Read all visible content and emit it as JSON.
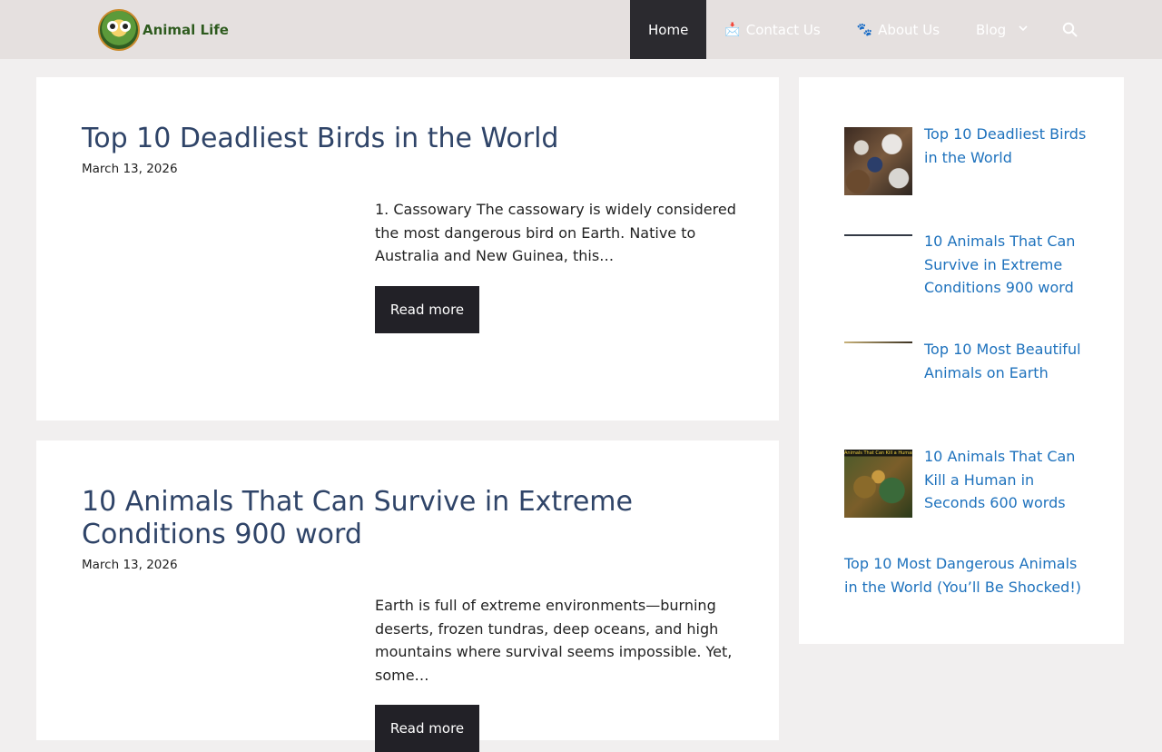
{
  "header": {
    "logo_text": "Animal Life",
    "nav": [
      {
        "label": "Home",
        "icon": ""
      },
      {
        "label": "Contact Us",
        "icon": "📩"
      },
      {
        "label": "About Us",
        "icon": "🐾"
      },
      {
        "label": "Blog",
        "icon": ""
      }
    ]
  },
  "posts": [
    {
      "title": "Top 10 Deadliest Birds in the World",
      "date": "March 13, 2026",
      "excerpt": "1. Cassowary The cassowary is widely considered the most dangerous bird on Earth. Native to Australia and New Guinea, this…",
      "read_more": "Read more"
    },
    {
      "title": "10 Animals That Can Survive in Extreme Conditions 900 word",
      "date": "March 13, 2026",
      "excerpt": "Earth is full of extreme environments—burning deserts, frozen tundras, deep oceans, and high mountains where survival seems impossible. Yet, some…",
      "read_more": "Read more"
    }
  ],
  "sidebar": {
    "items": [
      {
        "title": "Top 10 Deadliest Birds in the World"
      },
      {
        "title": "10 Animals That Can Survive in Extreme Conditions 900 word"
      },
      {
        "title": "Top 10 Most Beautiful Animals on Earth"
      },
      {
        "title": "10 Animals That Can Kill a Human in Seconds 600 words",
        "thumb_caption": "Animals That Can Kill a Human in Seconds"
      },
      {
        "title": "Top 10 Most Dangerous Animals in the World (You’ll Be Shocked!)"
      }
    ]
  },
  "colors": {
    "header_bg": "#e5e0df",
    "nav_active_bg": "#2b2a2f",
    "title_color": "#2f4468",
    "link_color": "#1e72bd",
    "button_bg": "#222127"
  }
}
